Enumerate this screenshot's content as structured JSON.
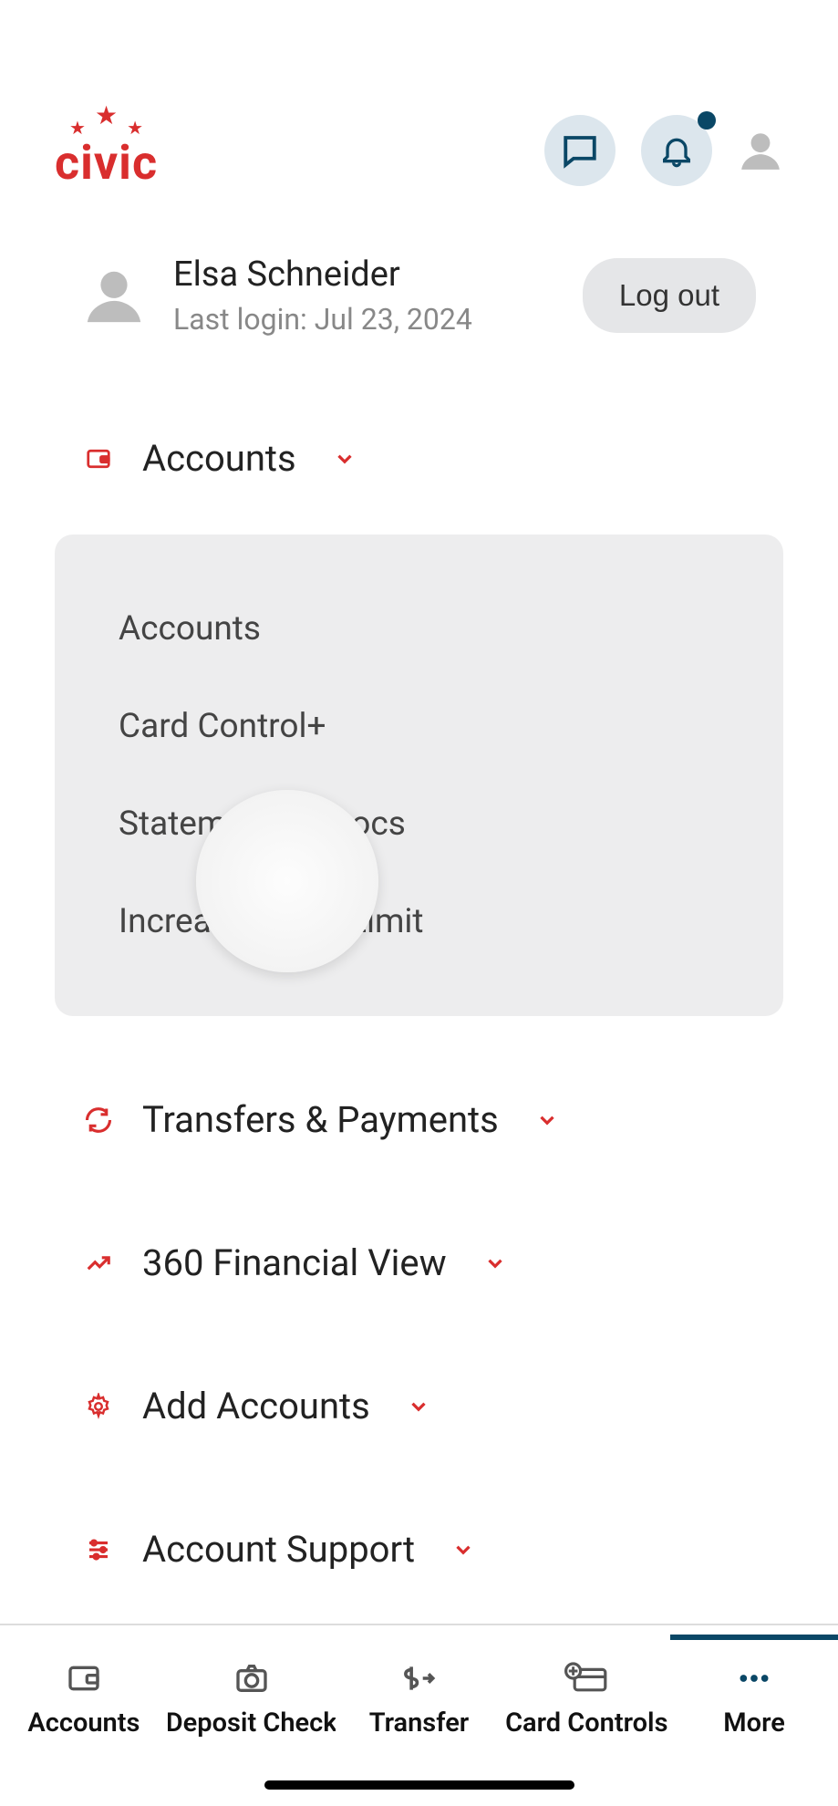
{
  "brand": {
    "name": "civic"
  },
  "user": {
    "name": "Elsa Schneider",
    "last_login_text": "Last login: Jul 23, 2024",
    "logout_label": "Log out"
  },
  "menu": {
    "accounts": {
      "label": "Accounts",
      "submenu": [
        "Accounts",
        "Card Control+",
        "Statements & Docs",
        "Increase credit Limit"
      ]
    },
    "transfers": {
      "label": "Transfers & Payments"
    },
    "financial_view": {
      "label": "360 Financial View"
    },
    "add_accounts": {
      "label": "Add Accounts"
    },
    "support": {
      "label": "Account Support"
    },
    "profile": {
      "label": "Profile"
    }
  },
  "bottom_nav": {
    "accounts": "Accounts",
    "deposit": "Deposit Check",
    "transfer": "Transfer",
    "card_control": "Card Controls",
    "more": "More"
  }
}
